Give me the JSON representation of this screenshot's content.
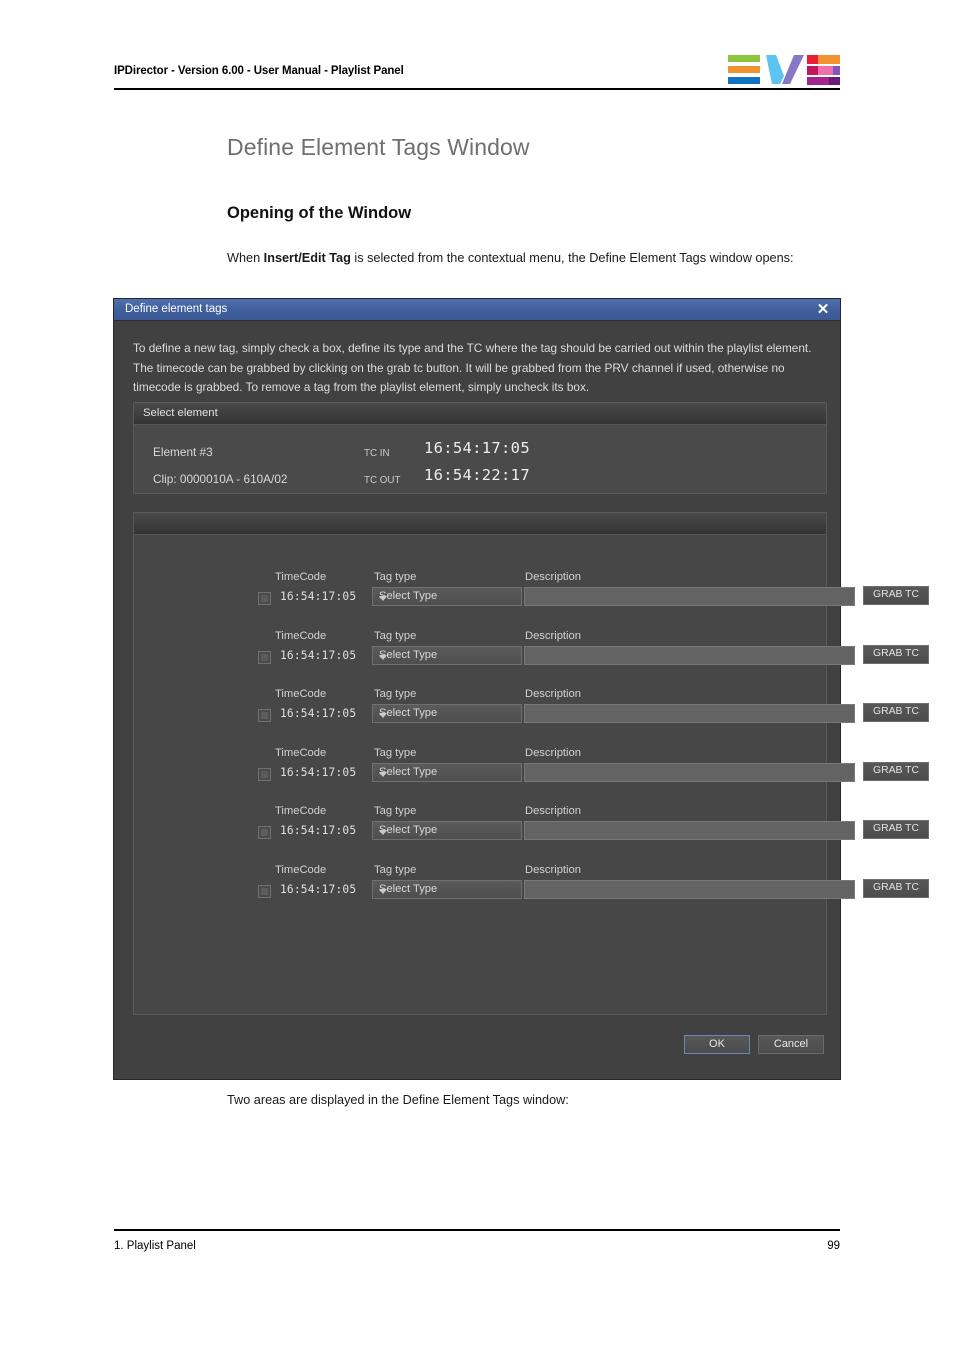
{
  "page": {
    "header_title": "IPDirector - Version 6.00 - User Manual - Playlist Panel",
    "heading1": "Define Element Tags Window",
    "heading2": "Opening of the Window",
    "intro_pre": "When ",
    "intro_bold": "Insert/Edit Tag",
    "intro_post": " is selected from the contextual menu, the Define Element Tags window opens:",
    "after_text": "Two areas are displayed in the Define Element Tags window:",
    "footer_left": "1. Playlist Panel",
    "footer_right": "99",
    "logo_name": "EVS",
    "colors": {
      "heading1": "#6f6f6f",
      "titlebar_blue": "#41619f",
      "dialog_bg": "#414141",
      "logo_green": "#8cc63f",
      "logo_orange": "#f29230",
      "logo_blue": "#0f75bc",
      "logo_lightblue": "#5bc4f1",
      "logo_purple": "#8878c3",
      "logo_red": "#ed1c33",
      "logo_pink": "#f06eaa",
      "logo_magenta": "#a2248f"
    }
  },
  "dialog": {
    "title": "Define element tags",
    "close_icon": "✕",
    "instructions": "To define a new tag, simply check a box, define its type and the TC where the tag should be carried out within the playlist element. The timecode can be grabbed by clicking on the grab tc button. It will be grabbed from the PRV channel if used, otherwise no timecode is grabbed. To remove a tag from the playlist element, simply uncheck its box.",
    "select_element": {
      "header": "Select element",
      "element_label": "Element #3",
      "clip_label": "Clip: 0000010A - 610A/02",
      "tc_in_label": "TC IN",
      "tc_in_value": "16:54:17:05",
      "tc_out_label": "TC OUT",
      "tc_out_value": "16:54:22:17"
    },
    "tags_section": {
      "header": "",
      "column_headers": {
        "timecode": "TimeCode",
        "tag_type": "Tag type",
        "description": "Description"
      },
      "grab_tc_label": "GRAB TC",
      "select_type_label": "Select Type",
      "rows": [
        {
          "checked": false,
          "timecode": "16:54:17:05",
          "tag_type": "Select Type",
          "description": "",
          "grab": "GRAB TC"
        },
        {
          "checked": false,
          "timecode": "16:54:17:05",
          "tag_type": "Select Type",
          "description": "",
          "grab": "GRAB TC"
        },
        {
          "checked": false,
          "timecode": "16:54:17:05",
          "tag_type": "Select Type",
          "description": "",
          "grab": "GRAB TC"
        },
        {
          "checked": false,
          "timecode": "16:54:17:05",
          "tag_type": "Select Type",
          "description": "",
          "grab": "GRAB TC"
        },
        {
          "checked": false,
          "timecode": "16:54:17:05",
          "tag_type": "Select Type",
          "description": "",
          "grab": "GRAB TC"
        },
        {
          "checked": false,
          "timecode": "16:54:17:05",
          "tag_type": "Select Type",
          "description": "",
          "grab": "GRAB TC"
        }
      ]
    },
    "buttons": {
      "ok": "OK",
      "cancel": "Cancel"
    }
  }
}
